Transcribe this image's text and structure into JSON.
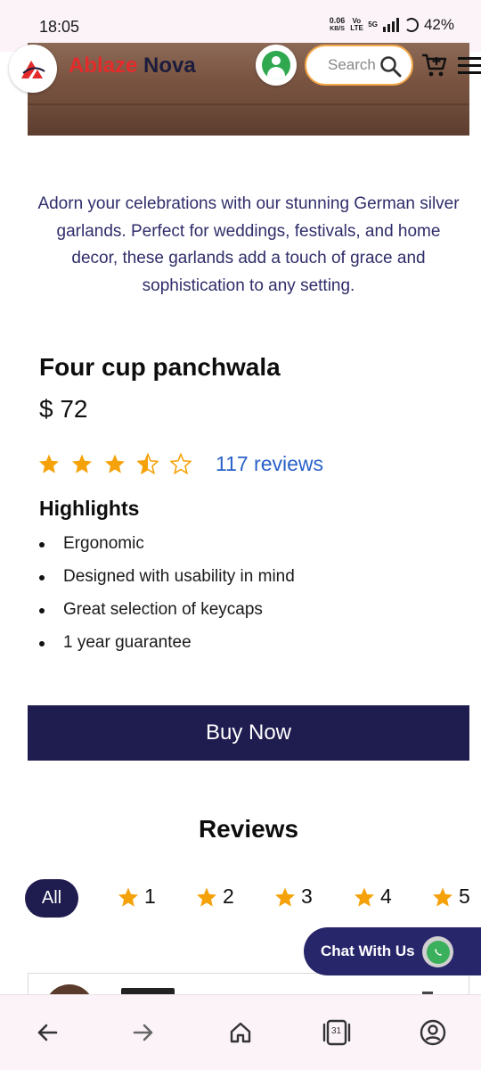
{
  "status_bar": {
    "time": "18:05",
    "net_speed": "0.06",
    "net_unit": "KB/S",
    "volte": "Vo LTE",
    "network": "5G",
    "battery": "42%"
  },
  "header": {
    "brand_part1": "Ablaze",
    "brand_part2": "Nova",
    "search_placeholder": "Search",
    "icons": [
      "logo-icon",
      "profile-icon",
      "search-icon",
      "cart-icon",
      "menu-icon"
    ]
  },
  "product": {
    "description": "Adorn your celebrations with our stunning German silver garlands. Perfect for weddings, festivals, and home decor, these garlands add a touch of grace and sophistication to any setting.",
    "title": "Four cup panchwala",
    "price": "$ 72",
    "rating": 3.5,
    "reviews_link": "117 reviews",
    "highlights_title": "Highlights",
    "highlights": [
      "Ergonomic",
      "Designed with usability in mind",
      "Great selection of keycaps",
      "1 year guarantee"
    ],
    "buy_label": "Buy Now"
  },
  "reviews": {
    "title": "Reviews",
    "filters": [
      "All",
      "1",
      "2",
      "3",
      "4",
      "5"
    ]
  },
  "chat": {
    "label": "Chat With Us"
  },
  "bottom_nav": {
    "tabs_count": "31",
    "items": [
      "back-icon",
      "forward-icon",
      "home-icon",
      "tabs-icon",
      "account-icon"
    ]
  },
  "colors": {
    "accent_dark": "#1f1c4f",
    "brand_red": "#e32b2b",
    "star": "#f5a20a",
    "link": "#2a62c9",
    "description": "#2f2d6a"
  }
}
